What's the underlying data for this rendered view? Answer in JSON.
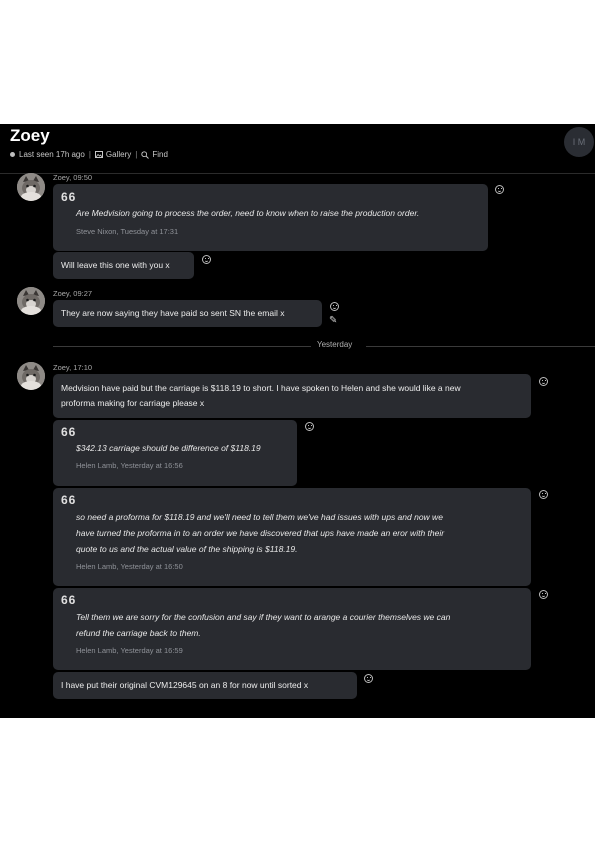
{
  "header": {
    "name": "Zoey",
    "status": "Last seen 17h ago",
    "gallery": "Gallery",
    "find": "Find",
    "avatar_initials": "I M"
  },
  "icons": [
    "status-dot-icon",
    "image-icon",
    "search-icon",
    "smile-icon",
    "pencil-icon",
    "quote-icon"
  ],
  "messages": {
    "g1": {
      "meta": "Zoey, 09:50",
      "quote": {
        "mark": "66",
        "text": "Are Medvision going to process the order, need to know when to raise the production order.",
        "source": "Steve Nixon, Tuesday at 17:31"
      },
      "reply": "Will leave this one with you x"
    },
    "g2": {
      "meta": "Zoey, 09:27",
      "text": "They are now saying they have paid so sent SN the email x"
    },
    "divider": "Yesterday",
    "g3": {
      "meta": "Zoey, 17:10",
      "msg1": [
        "Medvision have paid but the carriage is $118.19 to short. I have spoken to Helen and she would like a new",
        "proforma making for carriage please x"
      ],
      "quote1": {
        "mark": "66",
        "text": "$342.13 carriage should be difference of $118.19",
        "source": "Helen Lamb, Yesterday at 16:56"
      },
      "quote2": {
        "mark": "66",
        "lines": [
          "so need a proforma for $118.19 and we'll need to tell them we've had issues with ups and now we",
          "have turned the proforma in to an order we have discovered that ups have made an eror with their",
          "quote to us and the actual value of the shipping is $118.19."
        ],
        "source": "Helen Lamb, Yesterday at 16:50"
      },
      "quote3": {
        "mark": "66",
        "lines": [
          "Tell them we are sorry for the confusion and say if they want to arange a courier themselves we can",
          "refund the carriage back to them."
        ],
        "source": "Helen Lamb, Yesterday at 16:59"
      },
      "last": "I have put their original CVM129645 on an 8 for now until sorted x"
    }
  }
}
